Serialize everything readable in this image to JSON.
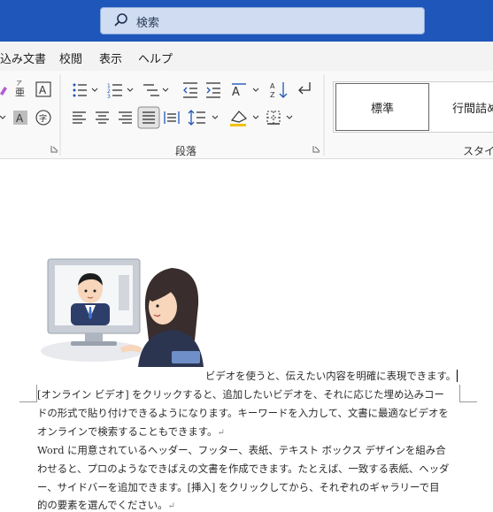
{
  "titlebar": {
    "search_placeholder": "検索"
  },
  "tabs": [
    {
      "label": "込み文書"
    },
    {
      "label": "校閲"
    },
    {
      "label": "表示"
    },
    {
      "label": "ヘルプ"
    }
  ],
  "ribbon": {
    "paragraph_group_title": "段落",
    "styles_group_title": "スタイル",
    "style_normal": "標準",
    "style_no_spacing": "行間詰め",
    "furigana_glyph": "ア亜",
    "char_border_glyph": "A",
    "char_shading_glyph": "A",
    "enclose_char_glyph": "字",
    "sort_glyph": "AZ"
  },
  "document": {
    "caption": "ビデオを使うと、伝えたい内容を明確に表現できます。",
    "para1_lines": [
      "[オンライン ビデオ] をクリックすると、追加したいビデオを、それに応じた埋め込みコー",
      "ドの形式で貼り付けできるようになります。キーワードを入力して、文書に最適なビデオを",
      "オンラインで検索することもできます。"
    ],
    "para2_lines": [
      "Word に用意されているヘッダー、フッター、表紙、テキスト ボックス デザインを組み合",
      "わせると、プロのようなできばえの文書を作成できます。たとえば、一致する表紙、ヘッダ",
      "ー、サイドバーを追加できます。[挿入] をクリックしてから、それぞれのギャラリーで目",
      "的の要素を選んでください。"
    ],
    "paragraph_mark": "↵"
  },
  "colors": {
    "titlebar": "#1e56b9",
    "search_bg": "#cfdcf2",
    "ribbon_bg": "#f9f9f9",
    "tab_bg": "#f3f3f3"
  }
}
